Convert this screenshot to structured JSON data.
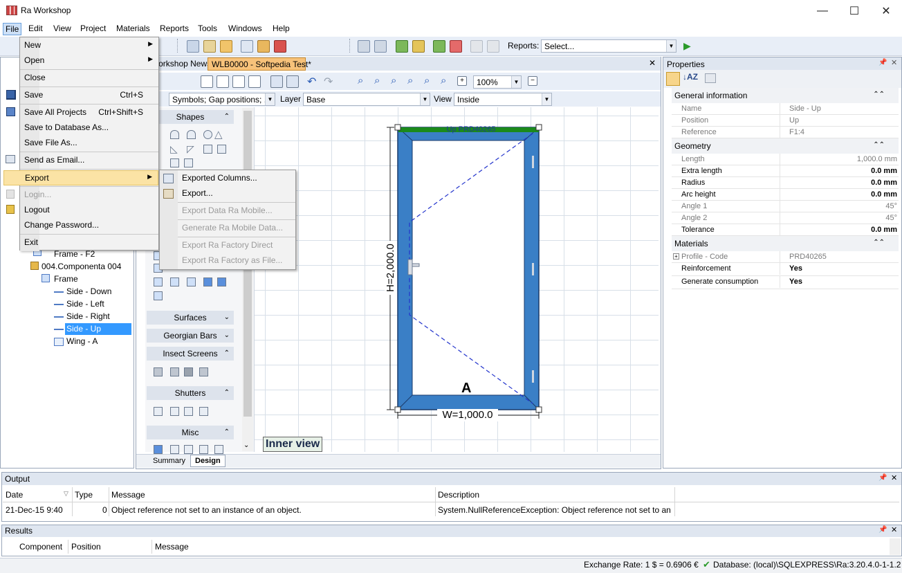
{
  "app": {
    "title": "Ra Workshop"
  },
  "window_controls": {
    "minimize": "—",
    "maximize": "☐",
    "close": "✕"
  },
  "menubar": [
    "File",
    "Edit",
    "View",
    "Project",
    "Materials",
    "Reports",
    "Tools",
    "Windows",
    "Help"
  ],
  "file_menu": {
    "new": "New",
    "open": "Open",
    "close": "Close",
    "save": "Save",
    "save_sc": "Ctrl+S",
    "save_all": "Save All Projects",
    "save_all_sc": "Ctrl+Shift+S",
    "save_db": "Save to Database As...",
    "save_file": "Save File As...",
    "send_email": "Send as Email...",
    "export": "Export",
    "login": "Login...",
    "logout": "Logout",
    "change_password": "Change Password...",
    "exit": "Exit"
  },
  "export_menu": {
    "exported_columns": "Exported Columns...",
    "export": "Export...",
    "export_mobile": "Export Data Ra Mobile...",
    "generate_mobile": "Generate Ra Mobile Data...",
    "factory_direct": "Export Ra Factory Direct",
    "factory_file": "Export Ra Factory as File..."
  },
  "toolbar": {
    "reports_label": "Reports:",
    "reports_value": "Select...",
    "zoom": "100%",
    "symbols": "Symbols; Gap positions; ...",
    "layer_label": "Layer",
    "layer_value": "Base",
    "view_label": "View",
    "view_value": "Inside"
  },
  "doc_tabs": {
    "news": "Workshop News",
    "active": "WLB0000 - Softpedia Test*",
    "close": "✕"
  },
  "tree": {
    "items": [
      "Frame - F2",
      "004.Componenta 004",
      "Frame",
      "Side - Down",
      "Side - Left",
      "Side - Right",
      "Side - Up",
      "Wing - A"
    ]
  },
  "shapes_panel": {
    "shapes": "Shapes",
    "surfaces": "Surfaces",
    "georgian": "Georgian Bars",
    "insect": "Insect Screens",
    "shutters": "Shutters",
    "misc": "Misc"
  },
  "drawing": {
    "profile_label": "Up PRD40265",
    "height": "H=2,000.0",
    "width": "W=1,000.0",
    "wing": "A",
    "inner_view": "Inner view"
  },
  "bottom_tabs": {
    "summary": "Summary",
    "design": "Design"
  },
  "properties": {
    "title": "Properties",
    "general": "General information",
    "name_k": "Name",
    "name_v": "Side - Up",
    "position_k": "Position",
    "position_v": "Up",
    "reference_k": "Reference",
    "reference_v": "F1:4",
    "geometry": "Geometry",
    "length_k": "Length",
    "length_v": "1,000.0 mm",
    "extra_k": "Extra length",
    "extra_v": "0.0 mm",
    "radius_k": "Radius",
    "radius_v": "0.0 mm",
    "arc_k": "Arc height",
    "arc_v": "0.0 mm",
    "angle1_k": "Angle 1",
    "angle1_v": "45°",
    "angle2_k": "Angle 2",
    "angle2_v": "45°",
    "tol_k": "Tolerance",
    "tol_v": "0.0 mm",
    "materials": "Materials",
    "profile_k": "Profile - Code",
    "profile_v": "PRD40265",
    "reinf_k": "Reinforcement",
    "reinf_v": "Yes",
    "gen_k": "Generate consumption",
    "gen_v": "Yes"
  },
  "output": {
    "title": "Output",
    "cols": [
      "Date",
      "Type",
      "Message",
      "Description"
    ],
    "row": {
      "date": "21-Dec-15 9:40",
      "type": "0",
      "message": "Object reference not set to an instance of an object.",
      "description": "System.NullReferenceException: Object reference not set to an inst..."
    }
  },
  "results": {
    "title": "Results",
    "cols": [
      "Component",
      "Position",
      "Message"
    ]
  },
  "status": {
    "exchange": "Exchange Rate: 1 $ = 0.6906 €",
    "database": "Database: (local)\\SQLEXPRESS\\Ra:3.20.4.0-1-1.2"
  }
}
